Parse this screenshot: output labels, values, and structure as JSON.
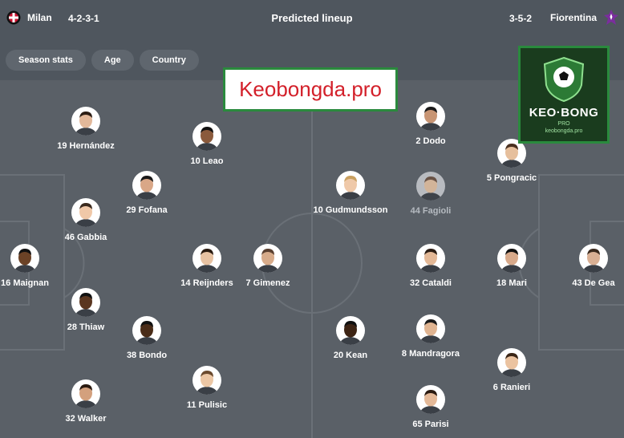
{
  "header": {
    "title": "Predicted lineup",
    "home_team": "Milan",
    "home_formation": "4-2-3-1",
    "away_team": "Fiorentina",
    "away_formation": "3-5-2"
  },
  "filters": [
    "Season stats",
    "Age",
    "Country"
  ],
  "watermark": {
    "text": "Keobongda.pro",
    "logo_text": "KEO·BONG",
    "logo_pro": "PRO",
    "logo_url": "keobongda.pro"
  },
  "colors": {
    "home_accent": "#c8102e",
    "away_accent": "#6a1e8c",
    "background": "#4f565e",
    "pitch": "#5a6067"
  },
  "players": [
    {
      "label": "19 Hernández"
    },
    {
      "label": "10 Leao"
    },
    {
      "label": "29 Fofana"
    },
    {
      "label": "46 Gabbia"
    },
    {
      "label": "16 Maignan"
    },
    {
      "label": "14 Reijnders"
    },
    {
      "label": "7 Gimenez"
    },
    {
      "label": "28 Thiaw"
    },
    {
      "label": "38 Bondo"
    },
    {
      "label": "11 Pulisic"
    },
    {
      "label": "32 Walker"
    },
    {
      "label": "2 Dodo"
    },
    {
      "label": "5 Pongracic"
    },
    {
      "label": "10 Gudmundsson"
    },
    {
      "label": "44 Fagioli"
    },
    {
      "label": "32 Cataldi"
    },
    {
      "label": "18 Mari"
    },
    {
      "label": "43 De Gea"
    },
    {
      "label": "20 Kean"
    },
    {
      "label": "8 Mandragora"
    },
    {
      "label": "6 Ranieri"
    },
    {
      "label": "65 Parisi"
    }
  ]
}
